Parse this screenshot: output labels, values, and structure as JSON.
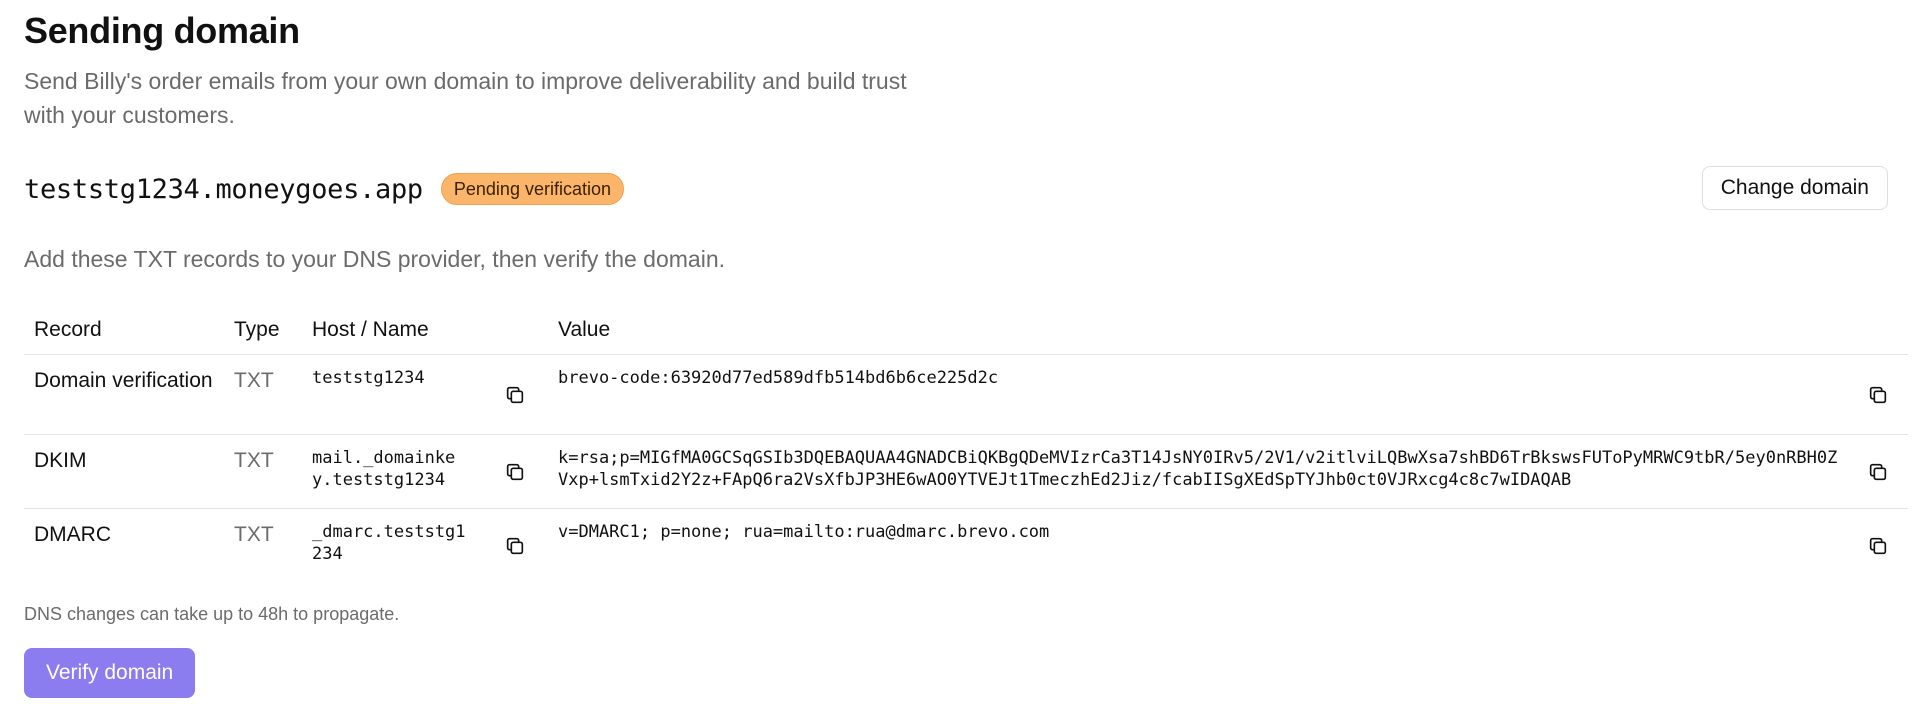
{
  "header": {
    "title": "Sending domain",
    "subtitle_line1": "Send Billy's order emails from your own domain to improve deliverability and build trust",
    "subtitle_line2": "with your customers."
  },
  "domain": {
    "name": "teststg1234.moneygoes.app",
    "status": "Pending verification",
    "status_color": "#fbb56a",
    "change_label": "Change domain"
  },
  "instructions": "Add these TXT records to your DNS provider, then verify the domain.",
  "table": {
    "columns": [
      "Record",
      "Type",
      "Host / Name",
      "Value"
    ],
    "rows": [
      {
        "record": "Domain verification",
        "type": "TXT",
        "host": "teststg1234",
        "value": "brevo-code:63920d77ed589dfb514bd6b6ce225d2c",
        "icon": "copy-icon"
      },
      {
        "record": "DKIM",
        "type": "TXT",
        "host": "mail._domainkey.teststg1234",
        "value": "k=rsa;p=MIGfMA0GCSqGSIb3DQEBAQUAA4GNADCBiQKBgQDeMVIzrCa3T14JsNY0IRv5/2V1/v2itlviLQBwXsa7shBD6TrBkswsFUToPyMRWC9tbR/5ey0nRBH0ZVxp+lsmTxid2Y2z+FApQ6ra2VsXfbJP3HE6wAO0YTVEJt1TmeczhEd2Jiz/fcabIISgXEdSpTYJhb0ct0VJRxcg4c8c7wIDAQAB",
        "icon": "copy-icon"
      },
      {
        "record": "DMARC",
        "type": "TXT",
        "host": "_dmarc.teststg1234",
        "value": "v=DMARC1; p=none; rua=mailto:rua@dmarc.brevo.com",
        "icon": "copy-icon"
      }
    ]
  },
  "footnote": "DNS changes can take up to 48h to propagate.",
  "verify_label": "Verify domain",
  "colors": {
    "accent": "#8b7cf0",
    "muted_text": "#6b6b6b",
    "border": "#e4e4e4"
  }
}
